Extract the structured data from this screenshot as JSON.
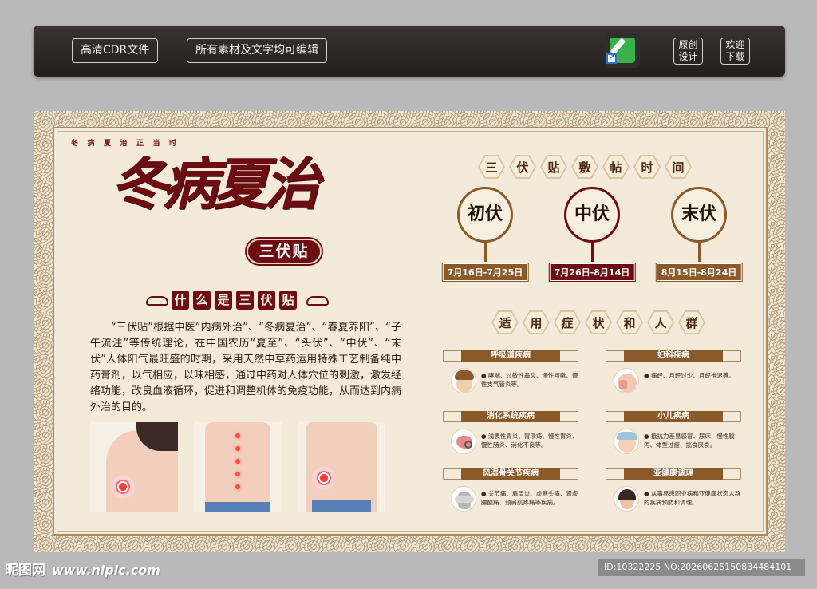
{
  "toolbar": {
    "btn_cdr": "高清CDR文件",
    "btn_edit": "所有素材及文字均可编辑",
    "app_icon": "coreldraw-app-icon",
    "original_line1": "原创",
    "original_line2": "设计",
    "download_line1": "欢迎",
    "download_line2": "下载"
  },
  "poster": {
    "subtitle": "冬病夏治正当时",
    "title": "冬病夏治",
    "badge": "三伏贴",
    "section_what": [
      "什",
      "么",
      "是",
      "三",
      "伏",
      "贴"
    ],
    "intro": "“三伏贴”根据中医“内病外治”、“冬病夏治”、“春夏养阳”、“子午流注”等传统理论，在中国农历“夏至”、“头伏”、“中伏”、“末伏”人体阳气最旺盛的时期，采用天然中草药运用特殊工艺制备纯中药膏剂，以气相应，以味相感，通过中药对人体穴位的刺激，激发经络功能，改良血液循环，促进和调整机体的免疫功能，从而达到内病外治的目的。",
    "photos": [
      "shoulder-photo",
      "back-photo",
      "lower-back-photo"
    ],
    "time_title": [
      "三",
      "伏",
      "贴",
      "敷",
      "帖",
      "时",
      "间"
    ],
    "periods": [
      {
        "name": "初伏",
        "date": "7月16日-7月25日",
        "color": "#8b5a2b"
      },
      {
        "name": "中伏",
        "date": "7月26日-8月14日",
        "color": "#6d0d12"
      },
      {
        "name": "末伏",
        "date": "8月15日-8月24日",
        "color": "#8b5a2b"
      }
    ],
    "symptom_title": [
      "适",
      "用",
      "症",
      "状",
      "和",
      "人",
      "群"
    ],
    "categories": [
      {
        "label": "呼吸道疾病",
        "text": "● 哮喘、过敏性鼻炎、慢性咳嗽、慢性支气管炎等。"
      },
      {
        "label": "妇科疾病",
        "text": "● 痛经、月经过少、月经推迟等。"
      },
      {
        "label": "消化系统疾病",
        "text": "● 浅表性胃炎、胃溃疡、慢性胃炎、慢性肠炎、消化不良等。"
      },
      {
        "label": "小儿疾病",
        "text": "● 抵抗力差易感冒、尿床、慢性腹泻、体型过瘦、挑食厌食。"
      },
      {
        "label": "风湿骨关节疾病",
        "text": "● 关节痛、肩周炎、虚寒头痛、肾虚腰酸痛、颈肩肌疼痛等疾病。"
      },
      {
        "label": "亚健康调理",
        "text": "● 从事易患职业病和亚健康状态人群的疾病预防和调理。"
      }
    ]
  },
  "watermark": {
    "logo": "昵图网",
    "site": "www.nipic.com",
    "id": "ID:10322225 NO:20260625150834484101"
  }
}
